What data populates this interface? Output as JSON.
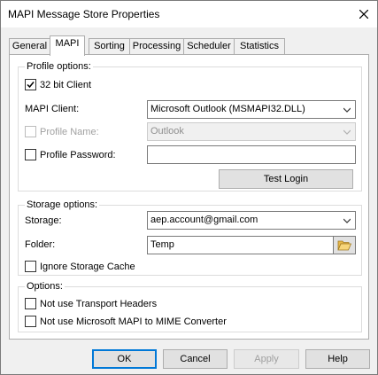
{
  "window": {
    "title": "MAPI Message Store Properties"
  },
  "tabs": [
    {
      "label": "General"
    },
    {
      "label": "MAPI",
      "active": true
    },
    {
      "label": "Sorting"
    },
    {
      "label": "Processing"
    },
    {
      "label": "Scheduler"
    },
    {
      "label": "Statistics"
    }
  ],
  "profile": {
    "group_label": "Profile options:",
    "bit32_label": "32 bit Client",
    "bit32_checked": true,
    "client_label": "MAPI Client:",
    "client_value": "Microsoft Outlook (MSMAPI32.DLL)",
    "profile_name_label": "Profile Name:",
    "profile_name_value": "Outlook",
    "profile_password_label": "Profile Password:",
    "profile_password_value": "",
    "test_login_label": "Test Login"
  },
  "storage": {
    "group_label": "Storage options:",
    "storage_label": "Storage:",
    "storage_value": "aep.account@gmail.com",
    "folder_label": "Folder:",
    "folder_value": "Temp",
    "ignore_cache_label": "Ignore Storage Cache"
  },
  "options": {
    "group_label": "Options:",
    "no_transport_headers_label": "Not use Transport Headers",
    "no_mime_converter_label": "Not use Microsoft MAPI to MIME Converter"
  },
  "footer": {
    "ok_label": "OK",
    "cancel_label": "Cancel",
    "apply_label": "Apply",
    "help_label": "Help"
  },
  "icons": {
    "close": "close-icon",
    "folder": "folder-open-icon",
    "dropdown": "chevron-down-icon",
    "check": "checkmark-icon"
  },
  "colors": {
    "default_button_border": "#0078d7",
    "folder_icon": "#e8b84a"
  }
}
